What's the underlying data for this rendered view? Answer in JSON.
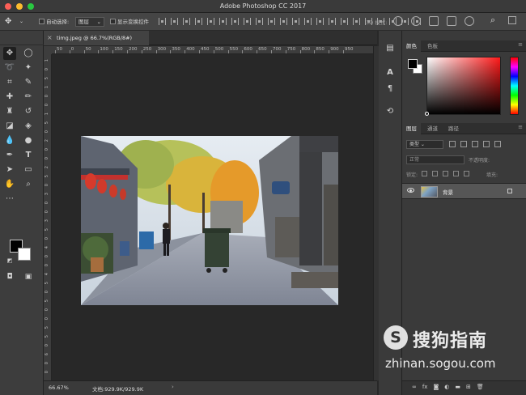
{
  "window": {
    "title": "Adobe Photoshop CC 2017"
  },
  "options_bar": {
    "auto_select_label": "自动选择:",
    "auto_select_value": "图层",
    "show_transform_label": "显示变换控件",
    "mode_3d_label": "3D 模式:"
  },
  "document": {
    "tab_title": "timg.jpeg @ 66.7%(RGB/8#)"
  },
  "rulers": {
    "top": [
      "50",
      "0",
      "50",
      "100",
      "150",
      "200",
      "250",
      "300",
      "350",
      "400",
      "450",
      "500",
      "550",
      "600",
      "650",
      "700",
      "750",
      "800",
      "850",
      "900",
      "950"
    ],
    "left": [
      "1",
      "0",
      "5",
      "1",
      "0",
      "0",
      "1",
      "5",
      "0",
      "2",
      "0",
      "0",
      "2",
      "5",
      "0",
      "3",
      "0",
      "0",
      "3",
      "5",
      "0",
      "4",
      "0",
      "0",
      "4",
      "5",
      "0",
      "5",
      "0",
      "0",
      "5",
      "5",
      "0",
      "6",
      "0",
      "0"
    ]
  },
  "status_bar": {
    "zoom": "66.67%",
    "doc_info": "文档:929.9K/929.9K",
    "arrow": "›"
  },
  "color_panel": {
    "tabs": [
      "颜色",
      "色板"
    ]
  },
  "layers_panel": {
    "tabs": [
      "图层",
      "通道",
      "路径"
    ],
    "search_placeholder": "类型",
    "blend_mode": "正常",
    "opacity_label": "不透明度:",
    "lock_label": "锁定:",
    "fill_label": "填充:",
    "layers": [
      {
        "name": "背景"
      }
    ]
  },
  "watermark": {
    "logo": "S",
    "brand": "搜狗指南",
    "url": "zhinan.sogou.com"
  }
}
